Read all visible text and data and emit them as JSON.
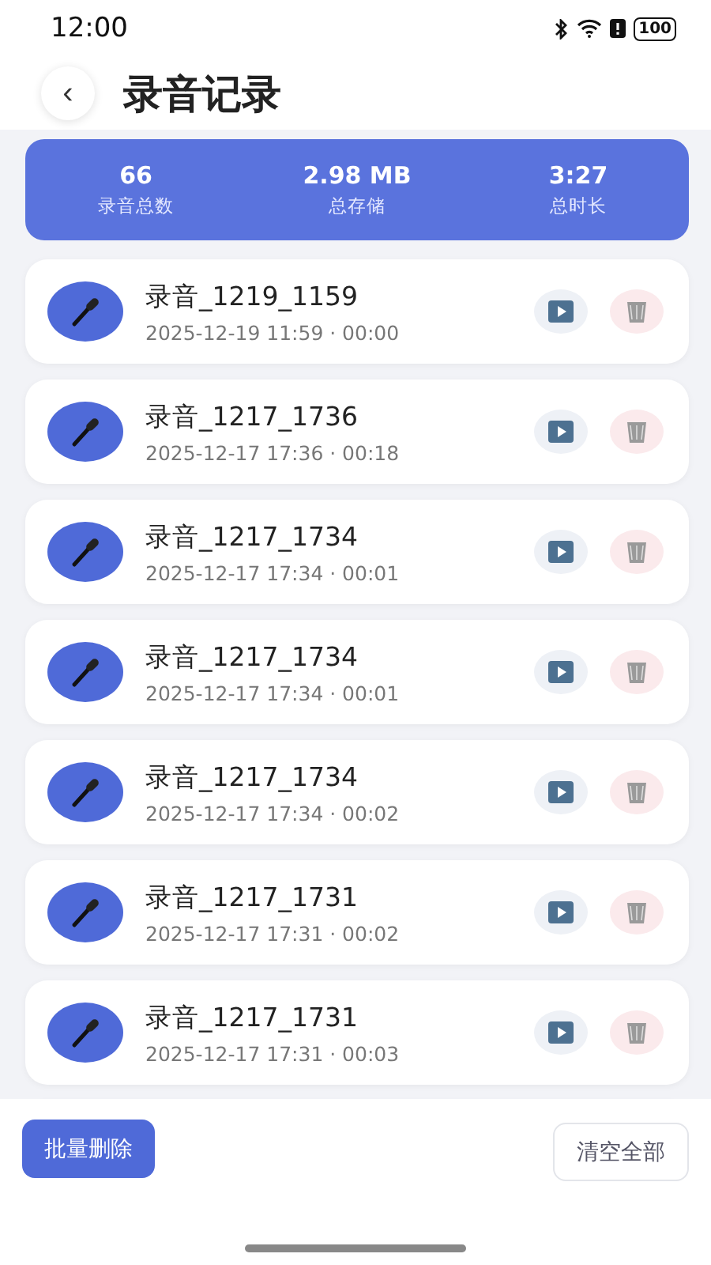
{
  "status_bar": {
    "time": "12:00",
    "battery": "100"
  },
  "header": {
    "back": "‹",
    "title": "录音记录"
  },
  "stats": [
    {
      "value": "66",
      "label": "录音总数"
    },
    {
      "value": "2.98 MB",
      "label": "总存储"
    },
    {
      "value": "3:27",
      "label": "总时长"
    }
  ],
  "recordings": [
    {
      "name": "录音_1219_1159",
      "meta": "2025-12-19 11:59 · 00:00"
    },
    {
      "name": "录音_1217_1736",
      "meta": "2025-12-17 17:36 · 00:18"
    },
    {
      "name": "录音_1217_1734",
      "meta": "2025-12-17 17:34 · 00:01"
    },
    {
      "name": "录音_1217_1734",
      "meta": "2025-12-17 17:34 · 00:01"
    },
    {
      "name": "录音_1217_1734",
      "meta": "2025-12-17 17:34 · 00:02"
    },
    {
      "name": "录音_1217_1731",
      "meta": "2025-12-17 17:31 · 00:02"
    },
    {
      "name": "录音_1217_1731",
      "meta": "2025-12-17 17:31 · 00:03"
    }
  ],
  "footer": {
    "batch_delete": "批量删除",
    "clear_all": "清空全部"
  }
}
